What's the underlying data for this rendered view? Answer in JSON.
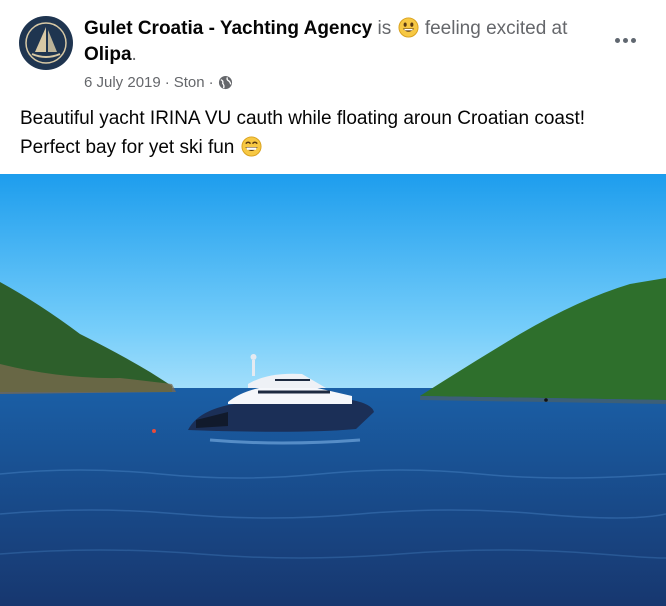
{
  "post": {
    "author": "Gulet Croatia - Yachting Agency",
    "activity_is": "is",
    "activity_feeling": "feeling excited at",
    "place": "Olipa",
    "place_suffix": ".",
    "date": "6 July 2019",
    "separator": "·",
    "location": "Ston",
    "privacy_icon": "globe-icon",
    "text_line1": "Beautiful yacht IRINA VU cauth while floating aroun Croatian coast!",
    "text_line2": "Perfect bay for yet ski fun",
    "feeling_emoji": "grinning-eyes-emoji",
    "text_emoji": "grinning-teeth-emoji"
  },
  "colors": {
    "sky": "#2fa8ee",
    "sea": "#1b4f93",
    "hills": "#2f6a2a",
    "muted_text": "#65676b"
  }
}
